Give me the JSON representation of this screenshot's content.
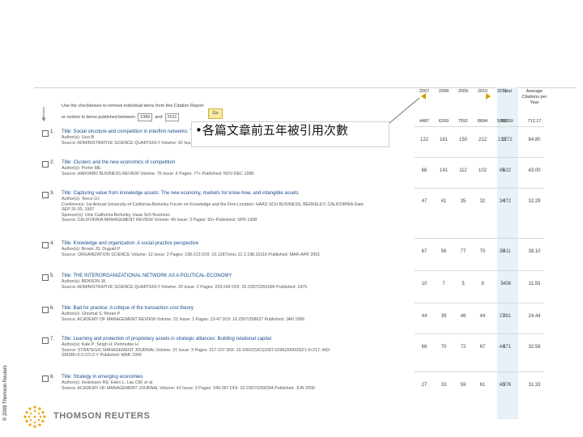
{
  "copyright": "© 2009 Thomson Reuters",
  "brand": "THOMSON REUTERS",
  "controls": {
    "instruction": "Use the checkboxes to remove individual items from this Citation Report",
    "published_label": "or restrict to items published between",
    "year_from": "1989",
    "and_label": "and",
    "year_to": "2011",
    "go_label": "Go"
  },
  "columns": {
    "years": [
      "2007",
      "2008",
      "2009",
      "2010",
      "2011"
    ],
    "total": "Total",
    "avg": "Average Citations per Year"
  },
  "totals": {
    "years": [
      "4487",
      "6269",
      "7591",
      "8684",
      "5068"
    ],
    "total": "50059",
    "avg": "712.17"
  },
  "callout": "•各篇文章前五年被引用次數",
  "entries": [
    {
      "num": "1.",
      "title": "Title: Social structure and competition in interfirm networks: The paradox of embeddedness",
      "lines": [
        "Author(s): Uzzi B",
        "Source: ADMINISTRATIVE SCIENCE QUARTERLY  Volume: 42  Issue: 1  Pages: 35-67  DOI: 10.2307/2393808  Published: MAR 1997"
      ],
      "cells": [
        "122",
        "181",
        "150",
        "212",
        "133"
      ],
      "total": "1272",
      "avg": "84.80"
    },
    {
      "num": "2.",
      "title": "Title: Clusters and the new economics of competition",
      "lines": [
        "Author(s): Porter ME",
        "Source: HARVARD BUSINESS REVIEW  Volume: 76  Issue: 6  Pages: 77+  Published: NOV-DEC 1998"
      ],
      "cells": [
        "66",
        "141",
        "112",
        "102",
        "45"
      ],
      "total": "622",
      "avg": "43.00"
    },
    {
      "num": "3.",
      "title": "Title: Capturing value from knowledge assets: The new economy, markets for know-how, and intangible assets",
      "lines": [
        "Author(s): Teece DJ",
        "Conference: 1st Annual University-of-California-Berkeley Forum on Knowledge and the Firm  Location: HAAS SCH BUSINESS, BERKELEY, CALIFORNIA  Date:",
        "SEP 26-30, 1997",
        "Sponsor(s): Univ California Berkeley, Haas Sch Business",
        "Source: CALIFORNIA MANAGEMENT REVIEW  Volume: 40  Issue: 3  Pages: 55+  Published: SPR 1998"
      ],
      "cells": [
        "47",
        "41",
        "35",
        "32",
        "34"
      ],
      "total": "472",
      "avg": "32.29"
    },
    {
      "num": "4.",
      "title": "Title: Knowledge and organization: A social-practice perspective",
      "lines": [
        "Author(s): Brown JS; Duguid P",
        "Source: ORGANIZATION SCIENCE  Volume: 12  Issue: 2  Pages: 198-213  DOI: 10.1287/orsc.12.2.198.10116  Published: MAR-APR 2001"
      ],
      "cells": [
        "67",
        "56",
        "77",
        "70",
        "35"
      ],
      "total": "411",
      "avg": "38.10"
    },
    {
      "num": "5.",
      "title": "Title: THE INTERORGANIZATIONAL NETWORK AS A POLITICAL-ECONOMY",
      "lines": [
        "Author(s): BENSON JK",
        "Source: ADMINISTRATIVE SCIENCE QUARTERLY  Volume: 20  Issue: 2  Pages: 229-249  DOI: 10.2307/2391696  Published: 1975"
      ],
      "cells": [
        "10",
        "7",
        "5",
        "9",
        "5"
      ],
      "total": "406",
      "avg": "11.93"
    },
    {
      "num": "6.",
      "title": "Title: Bad for practice: A critique of the transaction cost theory",
      "lines": [
        "Author(s): Ghoshal S; Moran P",
        "Source: ACADEMY OF MANAGEMENT REVIEW  Volume: 21  Issue: 1  Pages: 13-47  DOI: 10.2307/258627  Published: JAN 1996"
      ],
      "cells": [
        "44",
        "39",
        "46",
        "44",
        "27"
      ],
      "total": "391",
      "avg": "24.44"
    },
    {
      "num": "7.",
      "title": "Title: Learning and protection of proprietary assets in strategic alliances: Building relational capital",
      "lines": [
        "Author(s): Kale P; Singh H; Perlmutter H",
        "Source: STRATEGIC MANAGEMENT JOURNAL  Volume: 21  Issue: 3  Pages: 217-237  DOI: 10.1002/(SICI)1097-0266(200003)21:3<217::AID-",
        "SMJ95>3.0.CO;2-Y  Published: MAR 2000"
      ],
      "cells": [
        "66",
        "70",
        "72",
        "67",
        "44"
      ],
      "total": "371",
      "avg": "32.58"
    },
    {
      "num": "8.",
      "title": "Title: Strategy in emerging economies",
      "lines": [
        "Author(s): Hoskisson RE; Eden L; Lau CM; et al.",
        "Source: ACADEMY OF MANAGEMENT JOURNAL  Volume: 43  Issue: 3  Pages: 249-267  DOI: 10.2307/1556394  Published: JUN 2000"
      ],
      "cells": [
        "27",
        "33",
        "59",
        "61",
        "40"
      ],
      "total": "376",
      "avg": "31.33"
    }
  ]
}
